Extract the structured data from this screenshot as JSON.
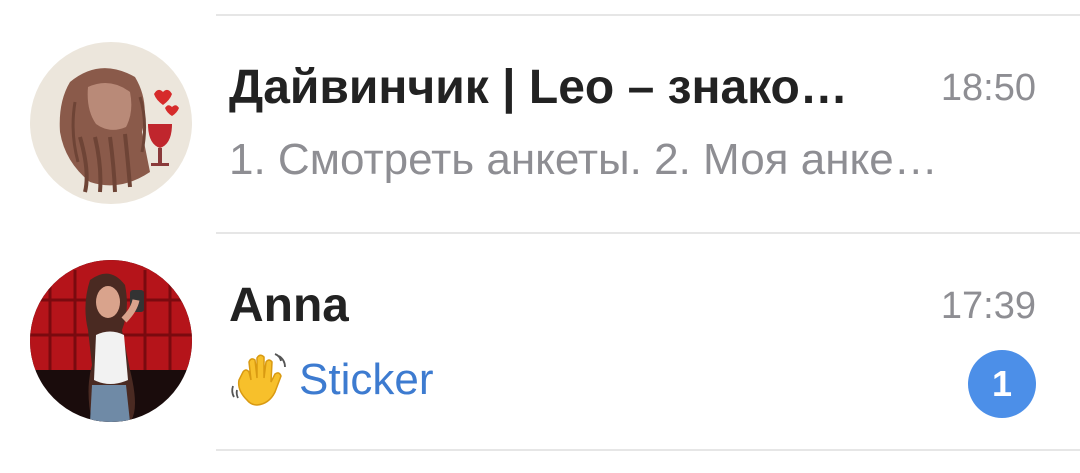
{
  "chats": [
    {
      "name": "Дайвинчик | Leo – знако…",
      "time": "18:50",
      "preview": "1. Смотреть анкеты. 2. Моя анке…",
      "avatar_icon": "leonardo-bot-avatar"
    },
    {
      "name": "Anna",
      "time": "17:39",
      "preview": "Sticker",
      "preview_icon": "waving-hand-emoji",
      "unread_count": "1",
      "avatar_icon": "user-photo-avatar"
    }
  ],
  "colors": {
    "name": "#222222",
    "time": "#8e8e93",
    "preview": "#8e8e93",
    "sticker_label": "#3d7bd0",
    "badge": "#4c8fe8",
    "divider": "#e6e6e6"
  }
}
